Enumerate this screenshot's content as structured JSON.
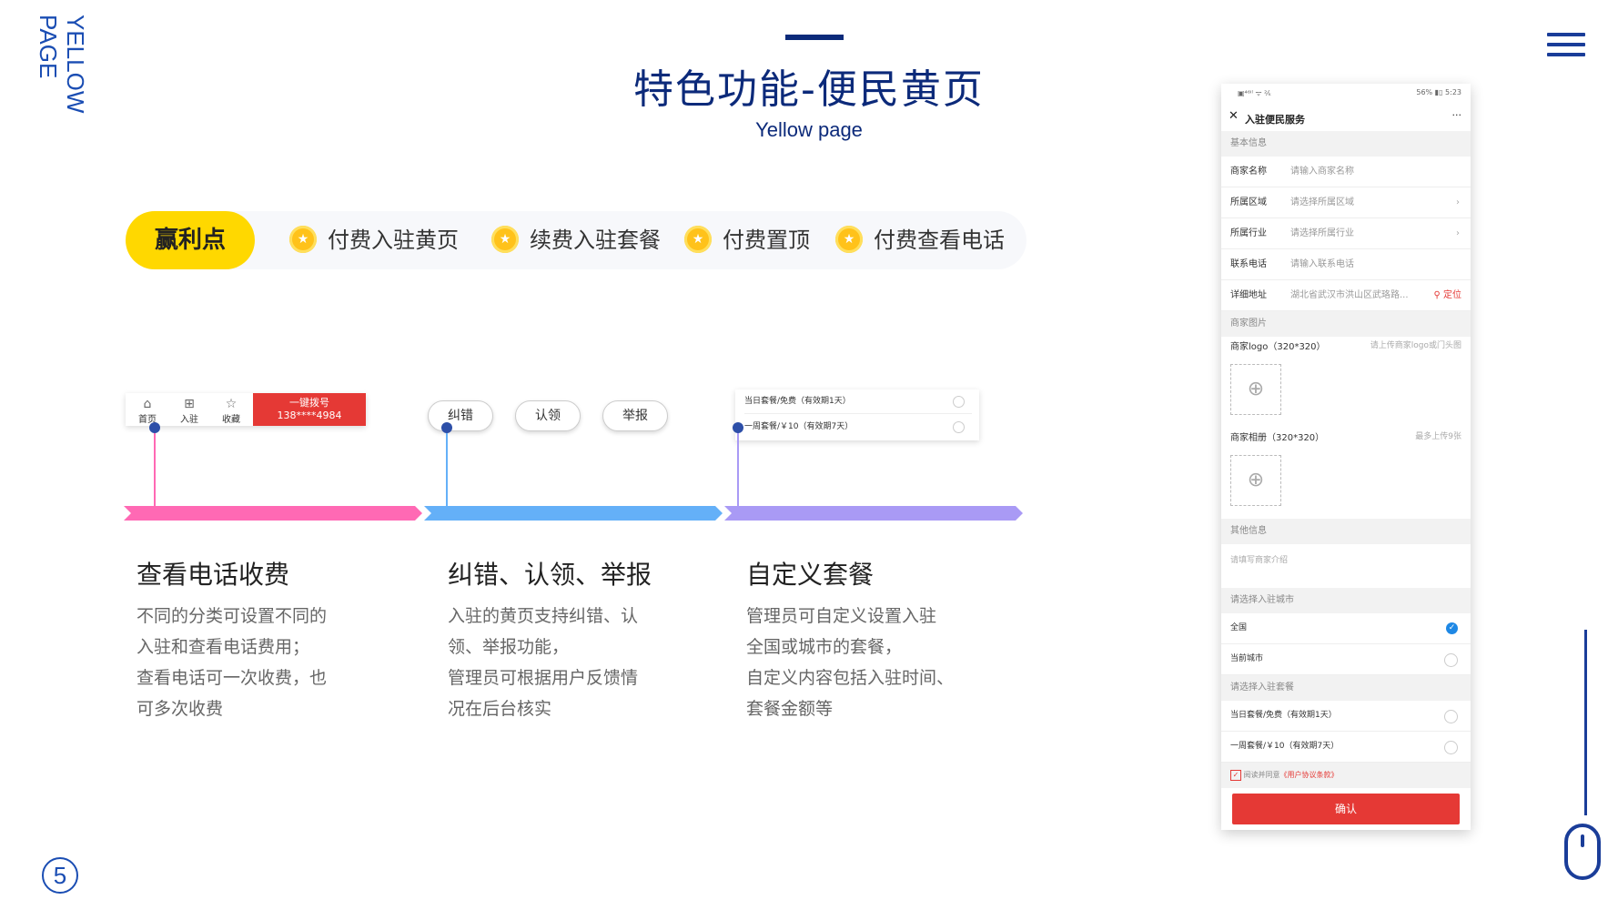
{
  "side_label": [
    "YELLOW",
    "PAGE"
  ],
  "page_number": "⑤",
  "header": {
    "title": "特色功能-便民黄页",
    "subtitle": "Yellow page"
  },
  "profit": {
    "label": "赢利点",
    "items": [
      "付费入驻黄页",
      "续费入驻套餐",
      "付费置顶",
      "付费查看电话"
    ]
  },
  "mini_nav": {
    "items": [
      "首页",
      "入驻",
      "收藏"
    ],
    "call_label": "一键拨号",
    "call_number": "138****4984"
  },
  "chips": [
    "纠错",
    "认领",
    "举报"
  ],
  "mini_packages": [
    "当日套餐/免费（有效期1天）",
    "一周套餐/￥10（有效期7天）"
  ],
  "timeline_colors": [
    "#ff69b4",
    "#64b0f8",
    "#a99af5"
  ],
  "features": [
    {
      "title": "查看电话收费",
      "lines": [
        "不同的分类可设置不同的",
        "入驻和查看电话费用；",
        "查看电话可一次收费，也",
        "可多次收费"
      ]
    },
    {
      "title": "纠错、认领、举报",
      "lines": [
        "入驻的黄页支持纠错、认",
        "领、举报功能，",
        "管理员可根据用户反馈情",
        "况在后台核实"
      ]
    },
    {
      "title": "自定义套餐",
      "lines": [
        "管理员可自定义设置入驻",
        "全国或城市的套餐，",
        "自定义内容包括入驻时间、",
        "套餐金额等"
      ]
    }
  ],
  "phone": {
    "status_left": "▣⁴⁶ᴵˡ ᯤ ²⁄ₖ",
    "status_right": "56% ▮▯ 5:23",
    "header_title": "入驻便民服务",
    "sections": {
      "basic": "基本信息",
      "images": "商家图片",
      "other": "其他信息",
      "city": "请选择入驻城市",
      "package": "请选择入驻套餐"
    },
    "fields": [
      {
        "key": "商家名称",
        "value": "请输入商家名称"
      },
      {
        "key": "所属区域",
        "value": "请选择所属区域"
      },
      {
        "key": "所属行业",
        "value": "请选择所属行业"
      },
      {
        "key": "联系电话",
        "value": "请输入联系电话"
      },
      {
        "key": "详细地址",
        "value": "湖北省武汉市洪山区武珞路..."
      }
    ],
    "locate_label": "定位",
    "logo_label": "商家logo（320*320）",
    "logo_hint": "请上传商家logo或门头图",
    "album_label": "商家相册（320*320）",
    "album_hint": "最多上传9张",
    "intro_placeholder": "请填写商家介绍",
    "cities": [
      "全国",
      "当前城市"
    ],
    "packages": [
      "当日套餐/免费（有效期1天）",
      "一周套餐/￥10（有效期7天）"
    ],
    "agree_text": "阅读并同意",
    "agree_link": "《用户协议条款》",
    "confirm": "确认"
  }
}
